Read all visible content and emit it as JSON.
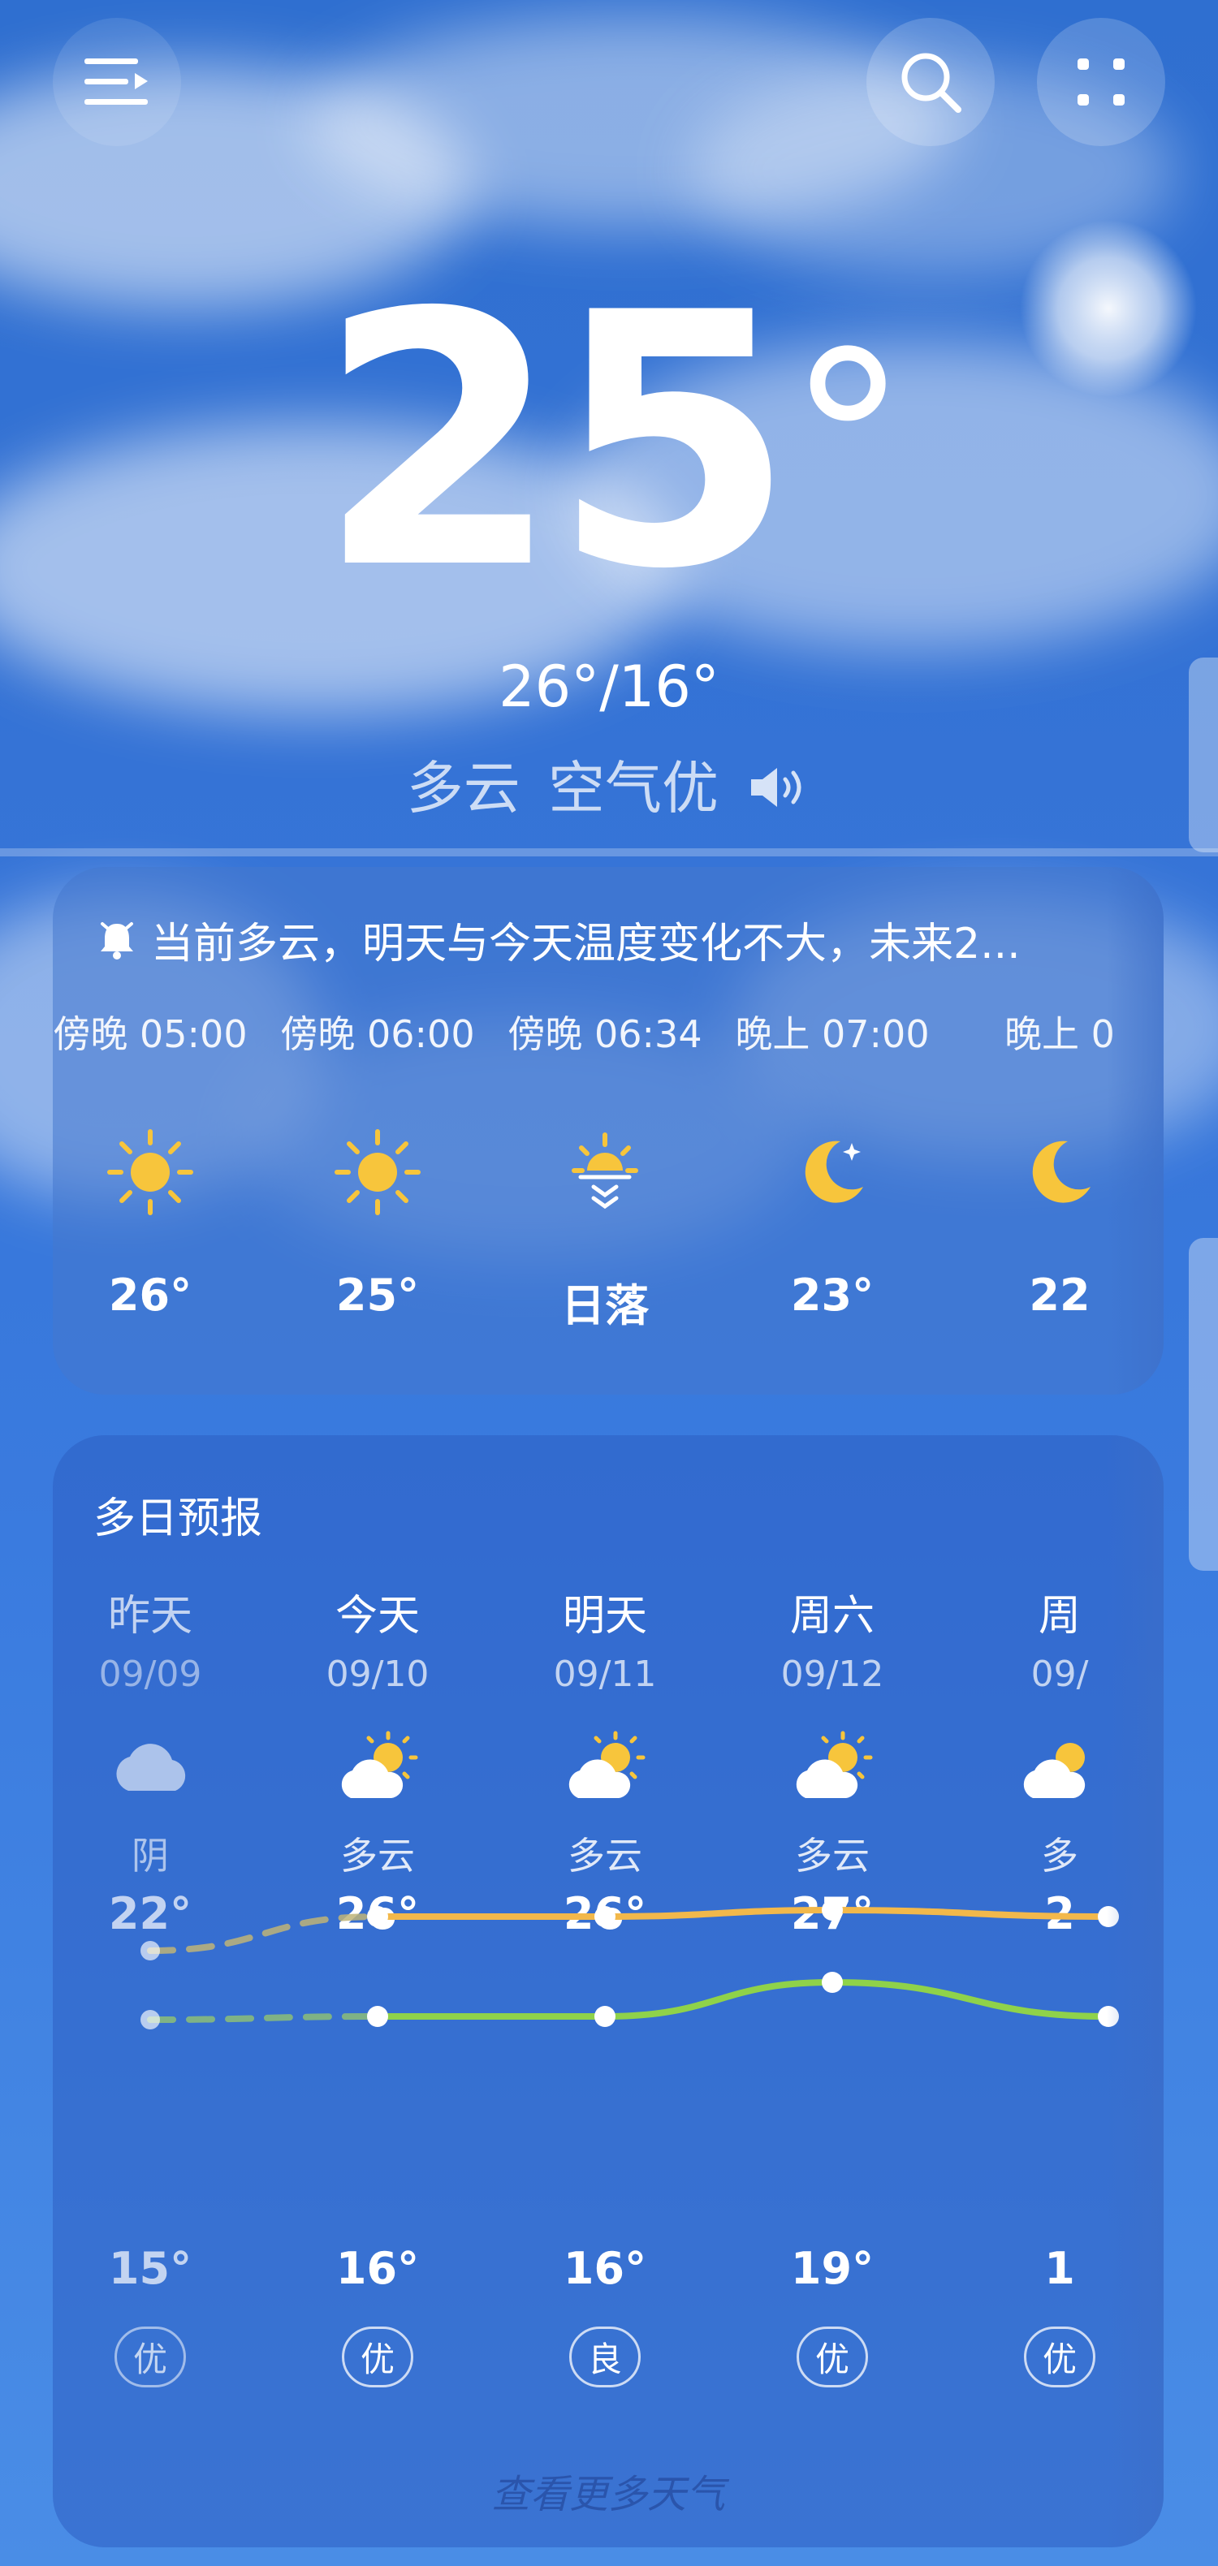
{
  "header": {
    "current_temp": "25",
    "degree_symbol": "°",
    "range": "26°/16°",
    "condition": "多云",
    "air_quality": "空气优"
  },
  "hourly": {
    "alert": "当前多云，明天与今天温度变化不大，未来2...",
    "items": [
      {
        "time": "傍晚 05:00",
        "icon": "sun-icon",
        "temp": "26°"
      },
      {
        "time": "傍晚 06:00",
        "icon": "sun-icon",
        "temp": "25°"
      },
      {
        "time": "傍晚 06:34",
        "icon": "sunset-icon",
        "temp": "日落"
      },
      {
        "time": "晚上 07:00",
        "icon": "moon-icon",
        "temp": "23°"
      },
      {
        "time": "晚上 0",
        "icon": "moon-icon",
        "temp": "22"
      }
    ]
  },
  "daily": {
    "title": "多日预报",
    "items": [
      {
        "day": "昨天",
        "date": "09/09",
        "icon": "cloud-icon",
        "cond": "阴",
        "high": "22°",
        "low": "15°",
        "aqi": "优",
        "high_value": 22,
        "low_value": 15
      },
      {
        "day": "今天",
        "date": "09/10",
        "icon": "partly-cloudy-icon",
        "cond": "多云",
        "high": "26°",
        "low": "16°",
        "aqi": "优",
        "high_value": 26,
        "low_value": 16
      },
      {
        "day": "明天",
        "date": "09/11",
        "icon": "partly-cloudy-icon",
        "cond": "多云",
        "high": "26°",
        "low": "16°",
        "aqi": "良",
        "high_value": 26,
        "low_value": 16
      },
      {
        "day": "周六",
        "date": "09/12",
        "icon": "partly-cloudy-icon",
        "cond": "多云",
        "high": "27°",
        "low": "19°",
        "aqi": "优",
        "high_value": 27,
        "low_value": 19
      },
      {
        "day": "周",
        "date": "09/",
        "icon": "partly-cloudy-icon",
        "cond": "多",
        "high": "2",
        "low": "1",
        "aqi": "优",
        "high_value": 26,
        "low_value": 16
      }
    ],
    "more_link": "查看更多天气",
    "colors": {
      "high_line": "#f2b84b",
      "low_line": "#8fd24a"
    }
  }
}
